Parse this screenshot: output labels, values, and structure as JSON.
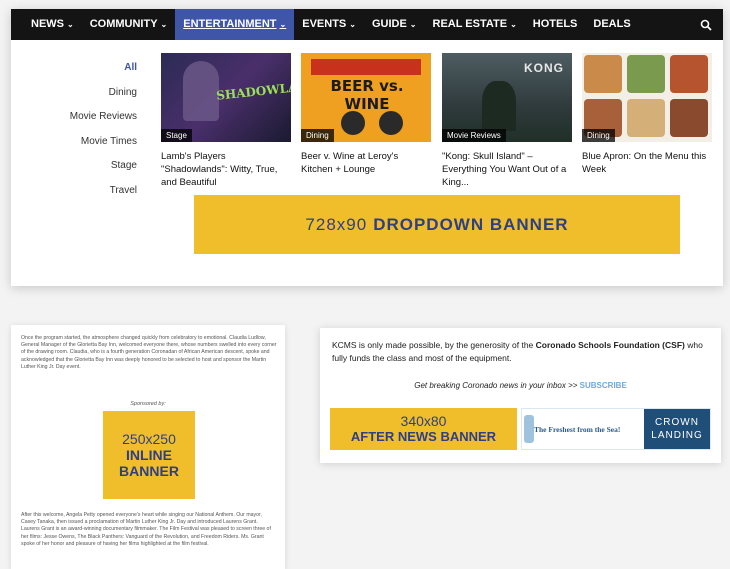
{
  "nav": {
    "items": [
      {
        "label": "NEWS",
        "chevron": true
      },
      {
        "label": "COMMUNITY",
        "chevron": true
      },
      {
        "label": "ENTERTAINMENT",
        "chevron": true,
        "active": true
      },
      {
        "label": "EVENTS",
        "chevron": true
      },
      {
        "label": "GUIDE",
        "chevron": true
      },
      {
        "label": "REAL ESTATE",
        "chevron": true
      },
      {
        "label": "HOTELS",
        "chevron": false
      },
      {
        "label": "DEALS",
        "chevron": false
      }
    ],
    "search_icon": "search-icon",
    "active_color": "#3f55a8"
  },
  "categories": [
    "All",
    "Dining",
    "Movie Reviews",
    "Movie Times",
    "Stage",
    "Travel"
  ],
  "cards": [
    {
      "tag": "Stage",
      "title": "Lamb's Players \"Shadowlands\": Witty, True, and Beautiful",
      "thumb_text": "SHADOWLANDS"
    },
    {
      "tag": "Dining",
      "title": "Beer v. Wine at Leroy's Kitchen + Lounge",
      "thumb_text": "BEER vs. WINE"
    },
    {
      "tag": "Movie Reviews",
      "title": "\"Kong: Skull Island\" – Everything You Want Out of a King...",
      "thumb_text": "KONG"
    },
    {
      "tag": "Dining",
      "title": "Blue Apron: On the Menu this Week",
      "thumb_text": ""
    }
  ],
  "dropdown_banner": {
    "size": "728x90",
    "label": "DROPDOWN BANNER"
  },
  "article": {
    "para1": "Once the program started, the atmosphere changed quickly from celebratory to emotional. Claudia Ludlow, General Manager of the Glorietta Bay Inn, welcomed everyone there, whose numbers swelled into every corner of the drawing room. Claudia, who is a fourth generation Coronadan of African American descent, spoke and acknowledged that the Glorietta Bay Inn was deeply honored to be selected to host and sponsor the Martin Luther King Jr. Day event.",
    "sponsored": "Sponsored by:",
    "para2": "After this welcome, Angela Petty opened everyone's heart while singing our National Anthem. Our mayor, Casey Tanaka, then issued a proclamation of Martin Luther King Jr. Day and introduced Laurens Grant. Laurens Grant is an award-winning documentary filmmaker. The Film Festival was pleased to screen three of her films: Jesse Owens, The Black Panthers: Vanguard of the Revolution, and Freedom Riders. Ms. Grant spoke of her honor and pleasure of having her films highlighted at the film festival."
  },
  "inline_banner": {
    "line1": "250x250",
    "line2": "INLINE",
    "line3": "BANNER"
  },
  "kcms": {
    "text_before": "KCMS is only made possible, by the generosity of the ",
    "org": "Coronado Schools Foundation (CSF)",
    "text_after": " who fully funds the class and most of the equipment.",
    "newsletter": "Get breaking Coronado news in your inbox >> ",
    "subscribe": "SUBSCRIBE"
  },
  "after_banner": {
    "line1": "340x80",
    "line2": "AFTER NEWS BANNER"
  },
  "crown_ad": {
    "tagline": "The Freshest from the Sea!",
    "brand1": "CROWN",
    "brand2": "LANDING"
  },
  "colors": {
    "banner_yellow": "#f0be2b",
    "banner_text": "#2e3f86"
  }
}
